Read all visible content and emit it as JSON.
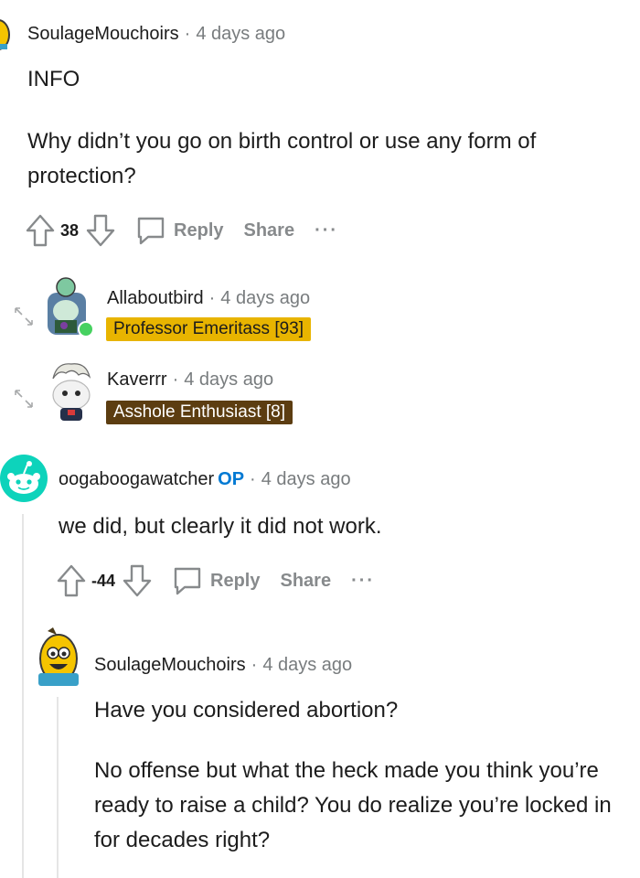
{
  "comment1": {
    "username": "SoulageMouchoirs",
    "time": "4 days ago",
    "paragraphs": [
      "INFO",
      "Why didn’t you go on birth control or use any form of protection?"
    ],
    "score": "38",
    "reply_label": "Reply",
    "share_label": "Share",
    "more_label": "···"
  },
  "collapsed": [
    {
      "username": "Allaboutbird",
      "time": "4 days ago",
      "flair": "Professor Emeritass [93]",
      "flair_bg": "#e8b400",
      "flair_color": "#1c1c1c"
    },
    {
      "username": "Kaverrr",
      "time": "4 days ago",
      "flair": "Asshole Enthusiast [8]",
      "flair_bg": "#5c3d11",
      "flair_color": "#ffffff"
    }
  ],
  "comment2": {
    "username": "oogaboogawatcher",
    "op_badge": "OP",
    "time": "4 days ago",
    "paragraphs": [
      "we did, but clearly it did not work."
    ],
    "score": "-44",
    "reply_label": "Reply",
    "share_label": "Share",
    "more_label": "···"
  },
  "comment3": {
    "username": "SoulageMouchoirs",
    "time": "4 days ago",
    "paragraphs": [
      "Have you considered abortion?",
      "No offense but what the heck made you think you’re ready to raise a child? You do realize you’re locked in for decades right?"
    ]
  },
  "colors": {
    "op_blue": "#0079d3",
    "meta_gray": "#787c7e",
    "snoo_teal": "#0dd3bb"
  }
}
